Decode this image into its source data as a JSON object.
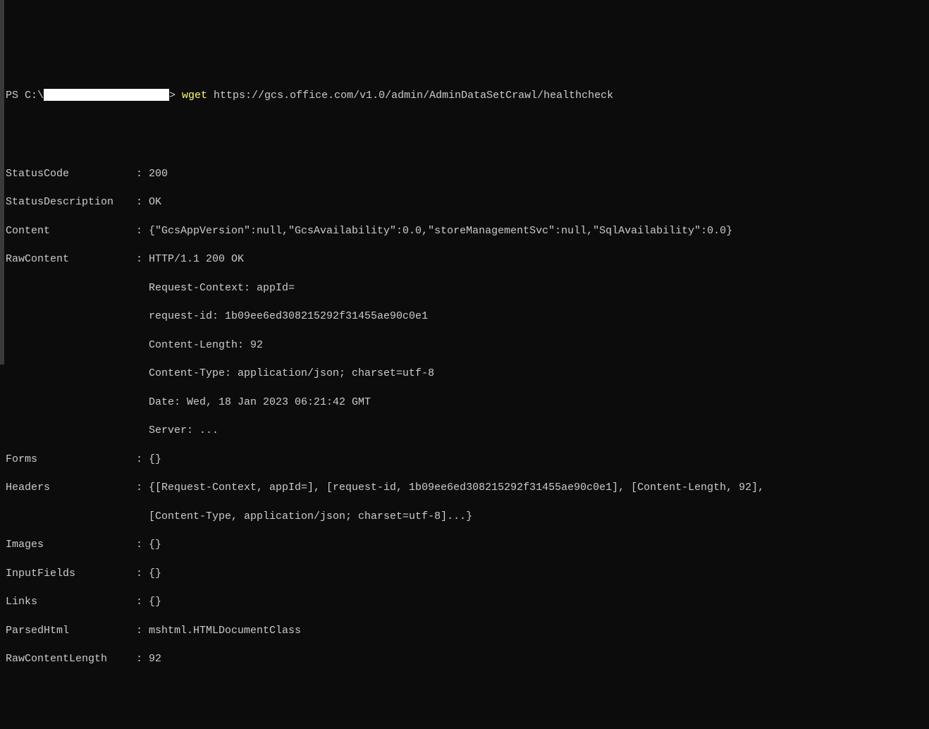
{
  "prompt": {
    "prefix": "PS C:\\",
    "gt": "> ",
    "cmd": "wget",
    "url": " https://gcs.office.com/v1.0/admin/AdminDataSetCrawl/healthcheck"
  },
  "output": {
    "StatusCode": "200",
    "StatusDescription": "OK",
    "Content": "{\"GcsAppVersion\":null,\"GcsAvailability\":0.0,\"storeManagementSvc\":null,\"SqlAvailability\":0.0}",
    "RawContent_line1": "HTTP/1.1 200 OK",
    "RawContent_line2": "Request-Context: appId=",
    "RawContent_line3": "request-id: 1b09ee6ed308215292f31455ae90c0e1",
    "RawContent_line4": "Content-Length: 92",
    "RawContent_line5": "Content-Type: application/json; charset=utf-8",
    "RawContent_line6": "Date: Wed, 18 Jan 2023 06:21:42 GMT",
    "RawContent_line7": "Server: ...",
    "Forms": "{}",
    "Headers_line1": "{[Request-Context, appId=], [request-id, 1b09ee6ed308215292f31455ae90c0e1], [Content-Length, 92],",
    "Headers_line2": "[Content-Type, application/json; charset=utf-8]...}",
    "Images": "{}",
    "InputFields": "{}",
    "Links": "{}",
    "ParsedHtml": "mshtml.HTMLDocumentClass",
    "RawContentLength": "92"
  },
  "labels": {
    "StatusCode": "StatusCode",
    "StatusDescription": "StatusDescription",
    "Content": "Content",
    "RawContent": "RawContent",
    "Forms": "Forms",
    "Headers": "Headers",
    "Images": "Images",
    "InputFields": "InputFields",
    "Links": "Links",
    "ParsedHtml": "ParsedHtml",
    "RawContentLength": "RawContentLength"
  }
}
